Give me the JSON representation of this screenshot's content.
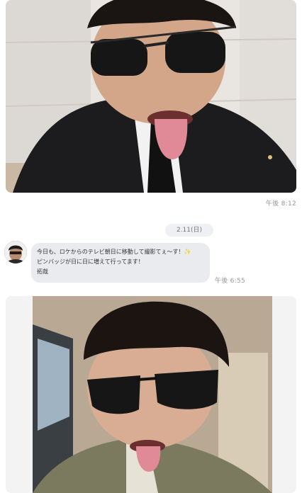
{
  "messages": [
    {
      "type": "photo",
      "timestamp": "午後 8:12"
    },
    {
      "type": "date",
      "date": "2.11(日)"
    },
    {
      "type": "text",
      "lines": [
        "今日も、ロケからのテレビ朝日に移動して撮影てぇ〜す！✨",
        "ピンバッジが日に日に増えて行ってます！",
        "拓哉"
      ],
      "timestamp": "午後 6:55"
    },
    {
      "type": "photo"
    }
  ]
}
